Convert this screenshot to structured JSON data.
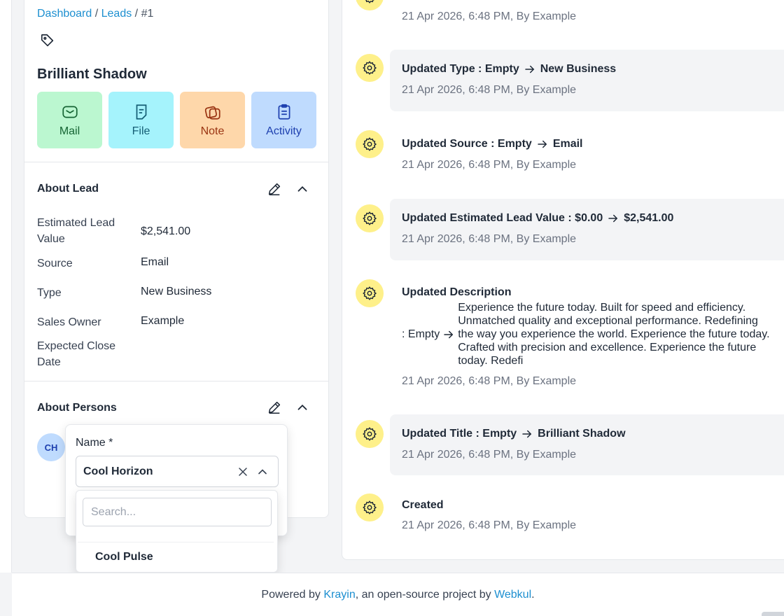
{
  "breadcrumb": {
    "dashboard": "Dashboard",
    "sep1": " / ",
    "leads": "Leads",
    "sep2": " / ",
    "current": "#1"
  },
  "lead": {
    "title": "Brilliant Shadow"
  },
  "actions": [
    {
      "label": "Mail",
      "icon": "mail-icon"
    },
    {
      "label": "File",
      "icon": "file-icon"
    },
    {
      "label": "Note",
      "icon": "note-icon"
    },
    {
      "label": "Activity",
      "icon": "activity-icon"
    }
  ],
  "about_lead": {
    "heading": "About Lead",
    "fields": [
      {
        "label": "Estimated Lead Value",
        "value": "$2,541.00"
      },
      {
        "label": "Source",
        "value": "Email"
      },
      {
        "label": "Type",
        "value": "New Business"
      },
      {
        "label": "Sales Owner",
        "value": "Example"
      },
      {
        "label": "Expected Close Date",
        "value": ""
      }
    ]
  },
  "about_persons": {
    "heading": "About Persons",
    "avatar_initials": "CH",
    "name_label": "Name *",
    "selected": "Cool Horizon",
    "search_placeholder": "Search...",
    "options": [
      "Cool Pulse"
    ]
  },
  "activities": [
    {
      "top_meta": "21 Apr 2026, 6:48 PM, By Example"
    },
    {
      "prefix": "Updated Type : Empty",
      "value": "New Business",
      "meta": "21 Apr 2026, 6:48 PM, By Example"
    },
    {
      "prefix": "Updated Source : Empty",
      "value": "Email",
      "meta": "21 Apr 2026, 6:48 PM, By Example"
    },
    {
      "prefix": "Updated Estimated Lead Value : $0.00",
      "value": "$2,541.00",
      "meta": "21 Apr 2026, 6:48 PM, By Example"
    },
    {
      "prefix": "Updated Description",
      "sub_prefix": ": Empty",
      "value": "Experience the future today. Built for speed and efficiency. Unmatched quality and exceptional performance. Redefining the way you experience the world. Experience the future today. Crafted with precision and excellence. Experience the future today. Redefi",
      "meta": "21 Apr 2026, 6:48 PM, By Example"
    },
    {
      "prefix": "Updated Title : Empty",
      "value": "Brilliant Shadow",
      "meta": "21 Apr 2026, 6:48 PM, By Example"
    },
    {
      "prefix": "Created",
      "meta": "21 Apr 2026, 6:48 PM, By Example"
    }
  ],
  "footer": {
    "prefix": "Powered by ",
    "krayin": "Krayin",
    "middle": ", an open-source project by ",
    "webkul": "Webkul",
    "suffix": "."
  },
  "colors": {
    "link": "#1d8fd0",
    "mail": "#bbf7d0",
    "file": "#a5f3fc",
    "note": "#fed7aa",
    "activity": "#bfdbfe",
    "gear": "#fef08a"
  }
}
